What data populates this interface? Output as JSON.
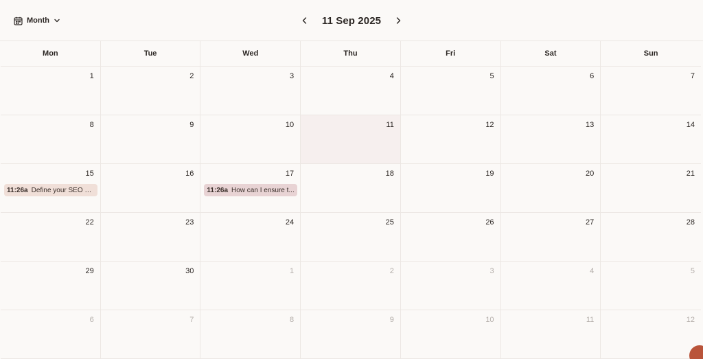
{
  "header": {
    "view_label": "Month",
    "date_title": "11 Sep 2025",
    "icons": {
      "view": "calendar-icon",
      "view_dropdown": "chevron-down-icon",
      "prev": "chevron-left-icon",
      "next": "chevron-right-icon"
    }
  },
  "weekdays": [
    "Mon",
    "Tue",
    "Wed",
    "Thu",
    "Fri",
    "Sat",
    "Sun"
  ],
  "weeks": [
    [
      {
        "d": "1"
      },
      {
        "d": "2"
      },
      {
        "d": "3"
      },
      {
        "d": "4"
      },
      {
        "d": "5"
      },
      {
        "d": "6"
      },
      {
        "d": "7"
      }
    ],
    [
      {
        "d": "8"
      },
      {
        "d": "9"
      },
      {
        "d": "10"
      },
      {
        "d": "11",
        "today": true
      },
      {
        "d": "12"
      },
      {
        "d": "13"
      },
      {
        "d": "14"
      }
    ],
    [
      {
        "d": "15"
      },
      {
        "d": "16"
      },
      {
        "d": "17"
      },
      {
        "d": "18"
      },
      {
        "d": "19"
      },
      {
        "d": "20"
      },
      {
        "d": "21"
      }
    ],
    [
      {
        "d": "22"
      },
      {
        "d": "23"
      },
      {
        "d": "24"
      },
      {
        "d": "25"
      },
      {
        "d": "26"
      },
      {
        "d": "27"
      },
      {
        "d": "28"
      }
    ],
    [
      {
        "d": "29"
      },
      {
        "d": "30"
      },
      {
        "d": "1",
        "other": true
      },
      {
        "d": "2",
        "other": true
      },
      {
        "d": "3",
        "other": true
      },
      {
        "d": "4",
        "other": true
      },
      {
        "d": "5",
        "other": true
      }
    ],
    [
      {
        "d": "6",
        "other": true
      },
      {
        "d": "7",
        "other": true
      },
      {
        "d": "8",
        "other": true
      },
      {
        "d": "9",
        "other": true
      },
      {
        "d": "10",
        "other": true
      },
      {
        "d": "11",
        "other": true
      },
      {
        "d": "12",
        "other": true
      }
    ]
  ],
  "events": [
    {
      "week": 2,
      "day": 0,
      "time": "11:26a",
      "title": "Define your SEO st...",
      "color": "#f0dfd8"
    },
    {
      "week": 2,
      "day": 2,
      "time": "11:26a",
      "title": "How can I ensure t...",
      "color": "#e8d3d4"
    }
  ],
  "colors": {
    "background": "#fbf9f7",
    "today_bg": "#f6efee",
    "grid_line": "#ece7e3",
    "muted_text": "#b4aeaa",
    "fab": "#b9543a"
  }
}
